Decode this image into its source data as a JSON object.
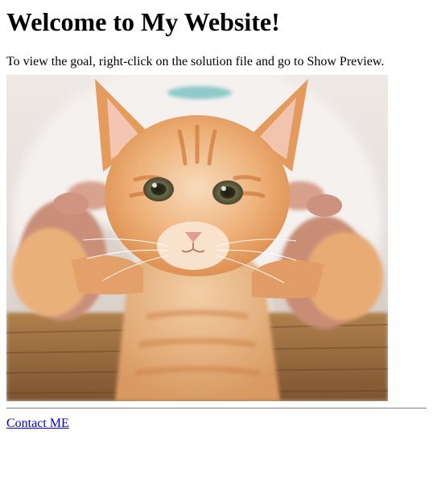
{
  "heading": "Welcome to My Website!",
  "intro": "To view the goal, right-click on the solution file and go to Show Preview.",
  "image": {
    "subject": "kitten-photo",
    "palette": {
      "background": "#e9e4e2",
      "fur": "#e8a66a",
      "fur_light": "#f5dcc0",
      "fur_stripe": "#cf7f3f",
      "eyes": "#5b5a3a",
      "nose": "#e59c98",
      "hands": "#d49983",
      "basket": "#9a6b3c"
    }
  },
  "footer": {
    "link_label": "Contact ME"
  }
}
